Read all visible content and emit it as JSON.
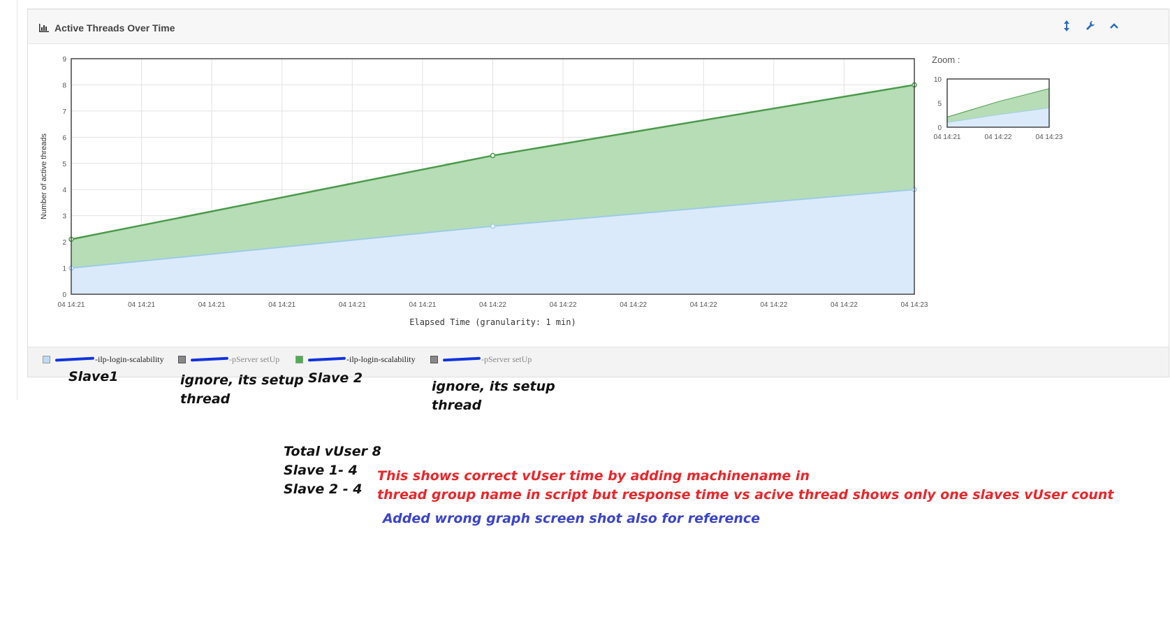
{
  "panel": {
    "title": "Active Threads Over Time",
    "icons": [
      "resize-vertical-icon",
      "wrench-icon",
      "chevron-up-icon"
    ]
  },
  "zoom": {
    "label": "Zoom :",
    "y_ticks": [
      "0",
      "5",
      "10"
    ],
    "x_ticks": [
      "04 14:21",
      "04 14:22",
      "04 14:23"
    ]
  },
  "legend": [
    {
      "text": "-ilp-login-scalability",
      "color": "#bcdcf5",
      "kind": "series"
    },
    {
      "text": "-pServer setUp",
      "color": "#888888",
      "kind": "setup"
    },
    {
      "text": "-ilp-login-scalability",
      "color": "#4caf50",
      "kind": "series"
    },
    {
      "text": "-pServer setUp",
      "color": "#888888",
      "kind": "setup"
    }
  ],
  "annotations": {
    "slave1": "Slave1",
    "ignore1_line1": "ignore, its setup",
    "ignore1_line2": "thread",
    "slave2": "Slave 2",
    "ignore2_line1": "ignore, its setup",
    "ignore2_line2": "thread",
    "total": "Total vUser 8",
    "slave1_count": "Slave 1- 4",
    "slave2_count": "Slave 2 - 4",
    "red_line1": "This shows correct vUser time by adding machinename in",
    "red_line2": "thread group name in script    but response time vs acive thread shows only one slaves vUser count",
    "blue_line": "Added wrong graph screen shot also for reference"
  },
  "chart_data": {
    "type": "area",
    "stacked": true,
    "title": "Active Threads Over Time",
    "xlabel": "Elapsed Time (granularity: 1 min)",
    "ylabel": "Number of active threads",
    "ylim": [
      0,
      9
    ],
    "y_ticks": [
      "0",
      "1",
      "2",
      "3",
      "4",
      "5",
      "6",
      "7",
      "8",
      "9"
    ],
    "x_tick_labels": [
      "04 14:21",
      "04 14:21",
      "04 14:21",
      "04 14:21",
      "04 14:21",
      "04 14:21",
      "04 14:22",
      "04 14:22",
      "04 14:22",
      "04 14:22",
      "04 14:22",
      "04 14:22",
      "04 14:23"
    ],
    "x": [
      "04 14:21",
      "04 14:22",
      "04 14:23"
    ],
    "series": [
      {
        "values": [
          1,
          2.6,
          4
        ],
        "color": "#bcdcf5",
        "line_color": "#9ecbe8",
        "stacked_top": [
          1,
          2.6,
          4
        ]
      },
      {
        "values": [
          1.1,
          2.7,
          4
        ],
        "color": "#a5d6a7",
        "line_color": "#4a9a4a",
        "stacked_top": [
          2.1,
          5.3,
          8
        ]
      }
    ],
    "grid": true,
    "legend_position": "bottom"
  }
}
